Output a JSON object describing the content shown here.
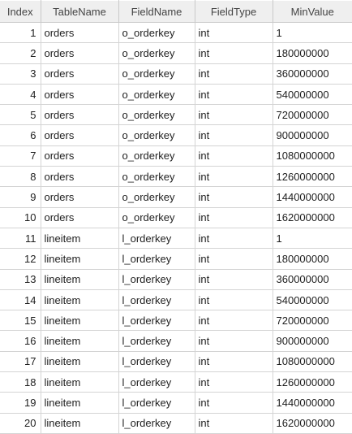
{
  "table": {
    "columns": [
      "Index",
      "TableName",
      "FieldName",
      "FieldType",
      "MinValue"
    ],
    "rows": [
      [
        "1",
        "orders",
        "o_orderkey",
        "int",
        "1"
      ],
      [
        "2",
        "orders",
        "o_orderkey",
        "int",
        "180000000"
      ],
      [
        "3",
        "orders",
        "o_orderkey",
        "int",
        "360000000"
      ],
      [
        "4",
        "orders",
        "o_orderkey",
        "int",
        "540000000"
      ],
      [
        "5",
        "orders",
        "o_orderkey",
        "int",
        "720000000"
      ],
      [
        "6",
        "orders",
        "o_orderkey",
        "int",
        "900000000"
      ],
      [
        "7",
        "orders",
        "o_orderkey",
        "int",
        "1080000000"
      ],
      [
        "8",
        "orders",
        "o_orderkey",
        "int",
        "1260000000"
      ],
      [
        "9",
        "orders",
        "o_orderkey",
        "int",
        "1440000000"
      ],
      [
        "10",
        "orders",
        "o_orderkey",
        "int",
        "1620000000"
      ],
      [
        "11",
        "lineitem",
        "l_orderkey",
        "int",
        "1"
      ],
      [
        "12",
        "lineitem",
        "l_orderkey",
        "int",
        "180000000"
      ],
      [
        "13",
        "lineitem",
        "l_orderkey",
        "int",
        "360000000"
      ],
      [
        "14",
        "lineitem",
        "l_orderkey",
        "int",
        "540000000"
      ],
      [
        "15",
        "lineitem",
        "l_orderkey",
        "int",
        "720000000"
      ],
      [
        "16",
        "lineitem",
        "l_orderkey",
        "int",
        "900000000"
      ],
      [
        "17",
        "lineitem",
        "l_orderkey",
        "int",
        "1080000000"
      ],
      [
        "18",
        "lineitem",
        "l_orderkey",
        "int",
        "1260000000"
      ],
      [
        "19",
        "lineitem",
        "l_orderkey",
        "int",
        "1440000000"
      ],
      [
        "20",
        "lineitem",
        "l_orderkey",
        "int",
        "1620000000"
      ]
    ]
  },
  "colors": {
    "header_background": "#efefef",
    "grid_line": "#d4d4d4"
  }
}
